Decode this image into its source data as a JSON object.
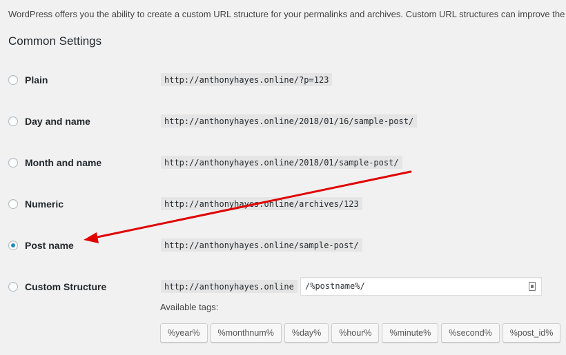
{
  "intro_text": "WordPress offers you the ability to create a custom URL structure for your permalinks and archives. Custom URL structures can improve the ae",
  "section_title": "Common Settings",
  "options": [
    {
      "label": "Plain",
      "example": "http://anthonyhayes.online/?p=123",
      "checked": false
    },
    {
      "label": "Day and name",
      "example": "http://anthonyhayes.online/2018/01/16/sample-post/",
      "checked": false
    },
    {
      "label": "Month and name",
      "example": "http://anthonyhayes.online/2018/01/sample-post/",
      "checked": false
    },
    {
      "label": "Numeric",
      "example": "http://anthonyhayes.online/archives/123",
      "checked": false
    },
    {
      "label": "Post name",
      "example": "http://anthonyhayes.online/sample-post/",
      "checked": true
    }
  ],
  "custom": {
    "label": "Custom Structure",
    "base": "http://anthonyhayes.online",
    "value": "/%postname%/",
    "checked": false
  },
  "available_tags_label": "Available tags:",
  "tags": [
    "%year%",
    "%monthnum%",
    "%day%",
    "%hour%",
    "%minute%",
    "%second%",
    "%post_id%"
  ],
  "annotation": {
    "color": "#e00000"
  },
  "colors": {
    "radio_checked": "#1e8cbe",
    "background": "#f1f1f1"
  }
}
